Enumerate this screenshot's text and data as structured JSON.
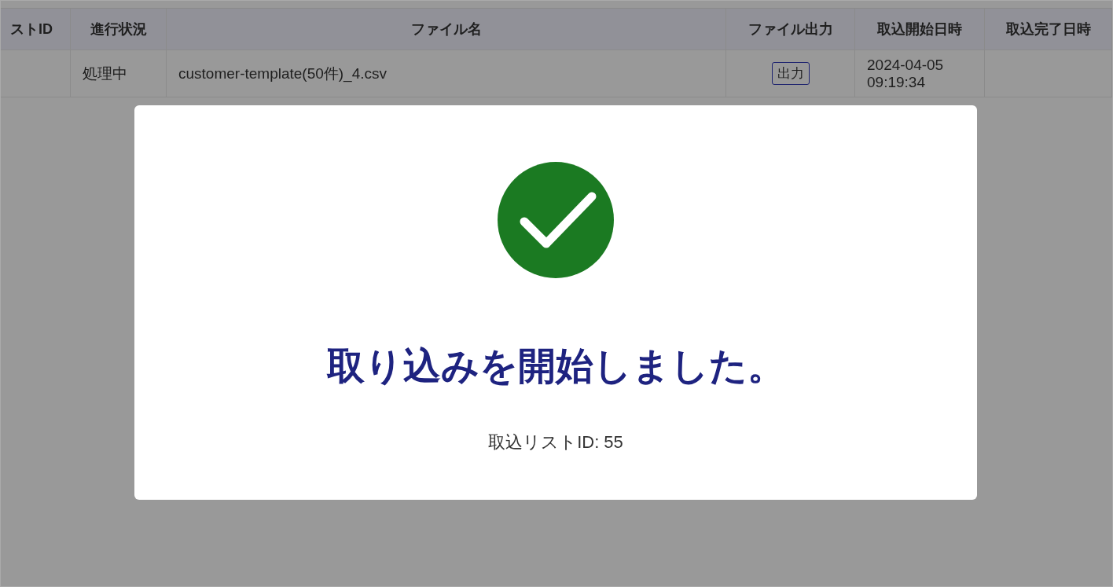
{
  "table": {
    "columns": [
      "ストID",
      "進行状況",
      "ファイル名",
      "ファイル出力",
      "取込開始日時",
      "取込完了日時"
    ],
    "rows": [
      {
        "status": "処理中",
        "file_name": "customer-template(50件)_4.csv",
        "export_button": "出力",
        "started_at": "2024-04-05 09:19:34"
      }
    ]
  },
  "dialog": {
    "kind": "success",
    "message": "取り込みを開始しました。",
    "detail": "取込リストID: 55"
  }
}
